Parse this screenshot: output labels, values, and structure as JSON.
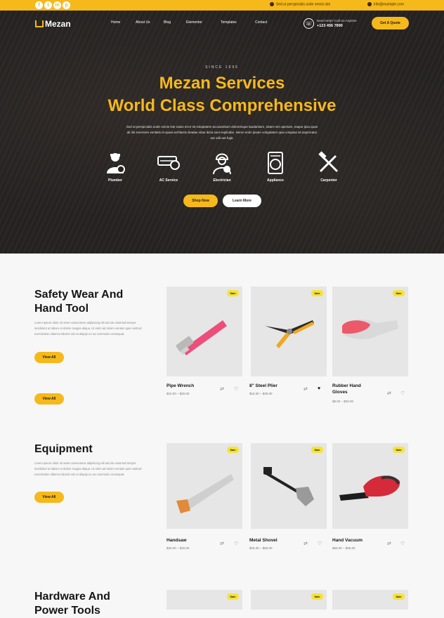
{
  "topbar": {
    "social": [
      "f",
      "t",
      "in",
      "p"
    ],
    "address": "Sed ut perspiciatis unde omnis iste",
    "email": "info@example.com"
  },
  "header": {
    "logo": "Mezan",
    "nav": [
      "Home",
      "About Us",
      "Blog",
      "Elementor",
      "Templates",
      "Contact"
    ],
    "phone_label": "Need Help? Call Us Anytime",
    "phone_number": "+123 456 7890",
    "cta": "Get A Quote"
  },
  "hero": {
    "kicker": "SINCE 1995",
    "title_line1": "Mezan Services",
    "title_line2": "World Class Comprehensive",
    "description": "Sed ut perspiciatis unde omnis iste natus error sit voluptatem accusantium doloremque laudantium, totam rem aperiam, eaque ipsa quae ab illo inventore veritatis et quasi architecto beatae vitae dicta sunt explicabo. Nemo enim ipsam voluptatem quia voluptas sit aspernatur aut odit aut fugit.",
    "services": [
      {
        "label": "Plumber",
        "icon": "plumber-icon"
      },
      {
        "label": "AC Service",
        "icon": "ac-icon"
      },
      {
        "label": "Electrician",
        "icon": "electrician-icon"
      },
      {
        "label": "Appliance",
        "icon": "appliance-icon"
      },
      {
        "label": "Carpenter",
        "icon": "carpenter-icon"
      }
    ],
    "btn_primary": "Shop Now",
    "btn_secondary": "Learn More"
  },
  "sections": [
    {
      "title_line1": "Safety Wear And",
      "title_line2": "Hand Tool",
      "text": "Lorem ipsum dolor sit amet consectetur adipiscing elit sed do eiusmod tempor incididunt ut labore et dolore magna aliqua. Ut enim ad minim veniam quis nostrud exercitation ullamco laboris nisi ut aliquip ex ea commodo consequat.",
      "btn": "View All",
      "btn2": "View All",
      "products": [
        {
          "name": "Pipe Wrench",
          "price": "$10.00 – $25.00",
          "badge": "Sale"
        },
        {
          "name": "8\" Steel Plier",
          "price": "$15.00 – $35.00",
          "badge": "Sale"
        },
        {
          "name": "Rubber Hand Gloves",
          "price": "$8.00 – $20.00",
          "badge": "Sale"
        }
      ]
    },
    {
      "title_line1": "Equipment",
      "text": "Lorem ipsum dolor sit amet consectetur adipiscing elit sed do eiusmod tempor incididunt ut labore et dolore magna aliqua. Ut enim ad minim veniam quis nostrud exercitation ullamco laboris nisi ut aliquip ex ea commodo consequat.",
      "btn": "View All",
      "products": [
        {
          "name": "Handsaw",
          "price": "$20.00 – $40.00",
          "badge": "Sale"
        },
        {
          "name": "Metal Shovel",
          "price": "$25.00 – $50.00",
          "badge": "Sale"
        },
        {
          "name": "Hand Vacuum",
          "price": "$60.00 – $90.00",
          "badge": "Sale"
        }
      ]
    },
    {
      "title_line1": "Hardware And",
      "title_line2": "Power Tools",
      "products": [
        {
          "badge": "Sale"
        },
        {
          "badge": "Sale"
        },
        {
          "badge": "Sale"
        }
      ]
    }
  ]
}
